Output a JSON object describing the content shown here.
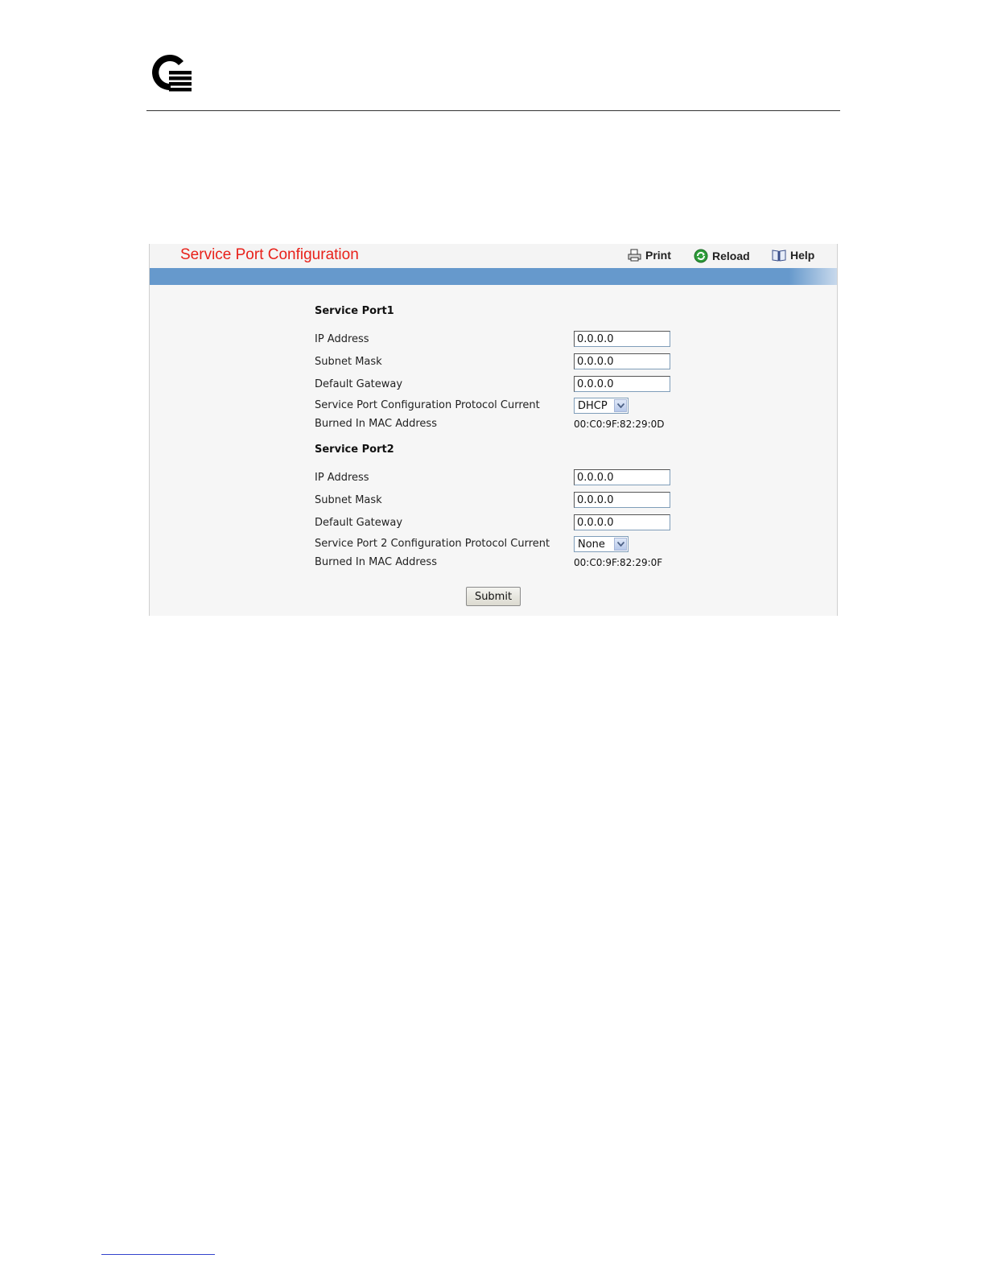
{
  "page": {
    "title": "Service Port Configuration",
    "toolbar": {
      "print_label": "Print",
      "reload_label": "Reload",
      "help_label": "Help"
    },
    "port1": {
      "heading": "Service Port1",
      "ip_label": "IP Address",
      "ip_value": "0.0.0.0",
      "mask_label": "Subnet Mask",
      "mask_value": "0.0.0.0",
      "gateway_label": "Default Gateway",
      "gateway_value": "0.0.0.0",
      "protocol_label": "Service Port Configuration Protocol Current",
      "protocol_value": "DHCP",
      "mac_label": "Burned In MAC Address",
      "mac_value": "00:C0:9F:82:29:0D"
    },
    "port2": {
      "heading": "Service Port2",
      "ip_label": "IP Address",
      "ip_value": "0.0.0.0",
      "mask_label": "Subnet Mask",
      "mask_value": "0.0.0.0",
      "gateway_label": "Default Gateway",
      "gateway_value": "0.0.0.0",
      "protocol_label": "Service Port 2 Configuration Protocol Current",
      "protocol_value": "None",
      "mac_label": "Burned In MAC Address",
      "mac_value": "00:C0:9F:82:29:0F"
    },
    "submit_label": "Submit"
  },
  "colors": {
    "title": "#e8211a",
    "bar": "#6699cc",
    "panel_bg": "#f6f6f6"
  },
  "icons": {
    "logo": "q-logo-icon",
    "print": "printer-icon",
    "reload": "reload-icon",
    "help": "book-help-icon"
  }
}
